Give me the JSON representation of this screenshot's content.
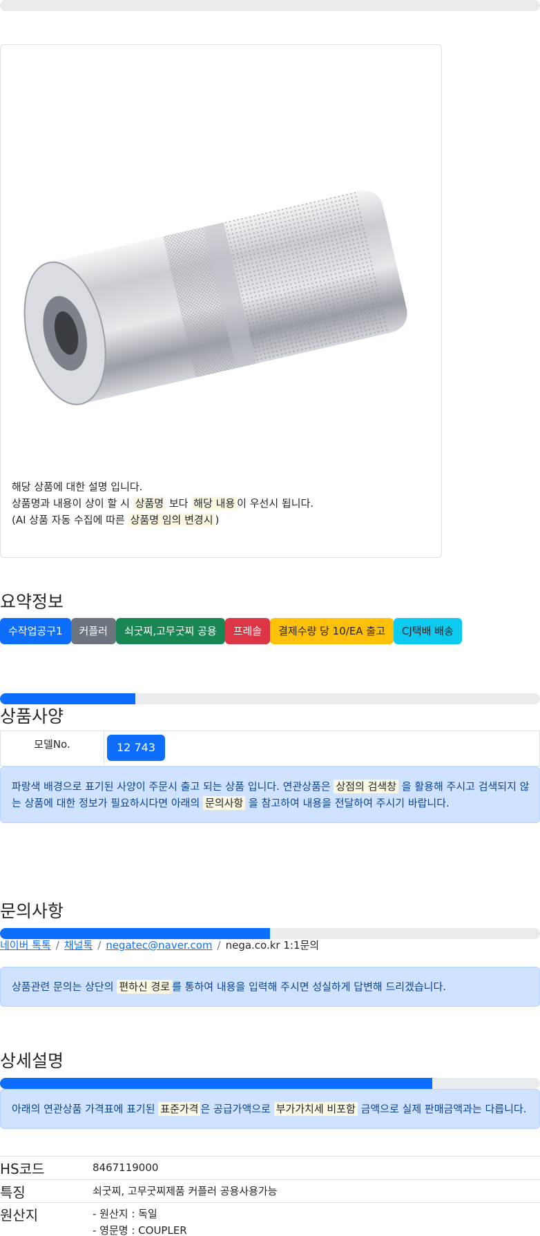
{
  "product_image": {
    "caption": {
      "line1": "해당 상품에 대한 설명 입니다.",
      "line2_pre": "상품명과 내용이 상이 할 시 ",
      "line2_mark1": "상품명",
      "line2_mid": " 보다 ",
      "line2_mark2": "해당 내용",
      "line2_post": "이 우선시 됩니다.",
      "line3_pre": "(AI 상품 자동 수집에 따른 ",
      "line3_mark": "상품명 임의 변경시",
      "line3_post": ")"
    }
  },
  "summary": {
    "heading": "요약정보",
    "badges": [
      {
        "label": "수작업공구1",
        "color": "#0d6efd"
      },
      {
        "label": "커플러",
        "color": "#6c757d"
      },
      {
        "label": "쇠굿찌,고무굿찌 공용",
        "color": "#198754"
      },
      {
        "label": "프레솔",
        "color": "#dc3545"
      },
      {
        "label": "결제수량 당 10/EA 출고",
        "color": "#ffc107"
      },
      {
        "label": "CJ택배 배송",
        "color": "#0dcaf0"
      }
    ]
  },
  "specs": {
    "heading": "상품사양",
    "progress_pct": 25,
    "model_label": "모델No.",
    "model_value": "12 743",
    "notice_pre": "파랑색 배경으로 표기된 사양이 주문시 출고 되는 상품 입니다. 연관상품은 ",
    "notice_mark1": "상점의 검색창",
    "notice_mid1": " 을 활용해 주시고 검색되지 않",
    "notice_line2_pre": "는 상품에 대한 정보가 필요하시다면 아래의 ",
    "notice_mark2": "문의사항",
    "notice_post": " 을 참고하여 내용을 전달하여 주시기 바랍니다."
  },
  "inquiry": {
    "heading": "문의사항",
    "progress_pct": 50,
    "links": [
      "네이버 톡톡",
      "채널톡",
      "negatec@naver.com"
    ],
    "plain": "nega.co.kr 1:1문의",
    "notice_pre": "상품관련 문의는 상단의 ",
    "notice_mark": "편하신 경로",
    "notice_post": "를 통하여 내용을 입력해 주시면 성실하게 답변해 드리겠습니다."
  },
  "details": {
    "heading": "상세설명",
    "progress_pct": 80,
    "notice_pre": "아래의 연관상품 가격표에 표기된 ",
    "notice_mark1": "표준가격",
    "notice_mid": "은 공급가액으로 ",
    "notice_mark2": "부가가치세 비포함",
    "notice_post": " 금액으로 실제 판매금액과는 다릅니다.",
    "rows": [
      {
        "key": "HS코드",
        "value": "8467119000"
      },
      {
        "key": "특징",
        "value": "쇠굿찌, 고무굿찌제품 커플러 공용사용가능"
      },
      {
        "key": "원산지",
        "value": "- 원산지 : 독일",
        "value2": "- 영문명 : COUPLER"
      }
    ]
  },
  "top_progress_pct": 0
}
